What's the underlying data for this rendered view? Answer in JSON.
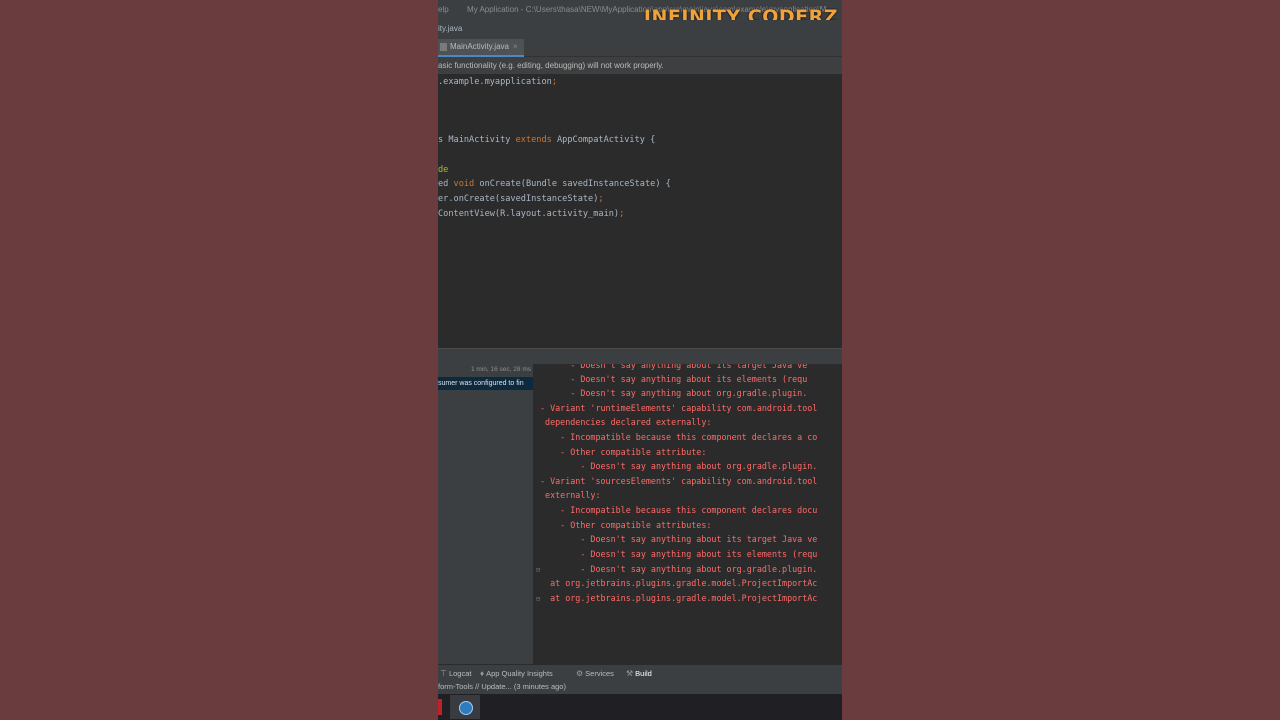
{
  "watermark": "INFINITY CODERZ",
  "titlebar": {
    "menu_help": "elp",
    "path": "My Application - C:\\Users\\thasa\\NEW\\MyApplication\\app\\src\\main\\java\\com\\example\\myapplication\\M"
  },
  "breadcrumb": "ity.java",
  "tab": {
    "label": "MainActivity.java",
    "close": "×"
  },
  "banner": "asic functionality (e.g. editing, debugging) will not work properly.",
  "code": [
    {
      "text": ".example.myapplication;"
    },
    {
      "text": "s MainActivity extends AppCompatActivity {"
    },
    {
      "text": "de"
    },
    {
      "text": "ed void onCreate(Bundle savedInstanceState) {"
    },
    {
      "text": "er.onCreate(savedInstanceState);"
    },
    {
      "text": "ContentView(R.layout.activity_main);"
    }
  ],
  "build": {
    "time": "1 min, 16 sec, 28 ms",
    "selected": "sumer was configured to fin"
  },
  "console": [
    "      - Doesn't say anything about its target Java ve",
    "      - Doesn't say anything about its elements (requ",
    "      - Doesn't say anything about org.gradle.plugin.",
    "- Variant 'runtimeElements' capability com.android.tool",
    " dependencies declared externally:",
    "    - Incompatible because this component declares a co",
    "    - Other compatible attribute:",
    "        - Doesn't say anything about org.gradle.plugin.",
    "- Variant 'sourcesElements' capability com.android.tool",
    " externally:",
    "    - Incompatible because this component declares docu",
    "    - Other compatible attributes:",
    "        - Doesn't say anything about its target Java ve",
    "        - Doesn't say anything about its elements (requ",
    "        - Doesn't say anything about org.gradle.plugin.",
    "  at org.jetbrains.plugins.gradle.model.ProjectImportAc",
    "  at org.jetbrains.plugins.gradle.model.ProjectImportAc"
  ],
  "tools": [
    {
      "label": "Logcat",
      "icon": "logcat-icon"
    },
    {
      "label": "App Quality Insights",
      "icon": "insights-icon"
    },
    {
      "label": "Services",
      "icon": "services-icon"
    },
    {
      "label": "Build",
      "icon": "hammer-icon"
    }
  ],
  "status": "form-Tools // Update... (3 minutes ago)"
}
